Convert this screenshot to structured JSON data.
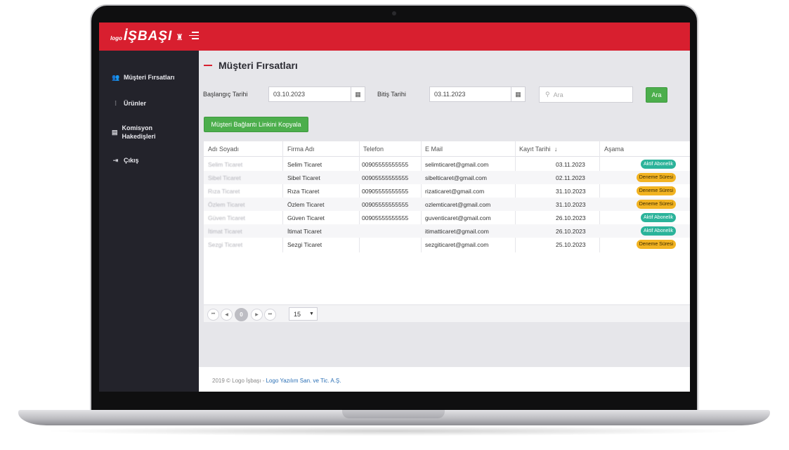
{
  "app": {
    "logo_small": "logo",
    "logo_main": "İŞBAŞI"
  },
  "sidebar": {
    "items": [
      {
        "label": "Müşteri Fırsatları",
        "icon": "users-icon"
      },
      {
        "label": "Ürünler",
        "icon": "sliders-icon"
      },
      {
        "label": "Komisyon Hakedişleri",
        "icon": "document-icon"
      },
      {
        "label": "Çıkış",
        "icon": "logout-icon"
      }
    ]
  },
  "page": {
    "title": "Müşteri Fırsatları"
  },
  "filters": {
    "start_label": "Başlangıç Tarihi",
    "start_value": "03.10.2023",
    "end_label": "Bitiş Tarihi",
    "end_value": "03.11.2023",
    "search_placeholder": "Ara",
    "search_button": "Ara",
    "copy_link_button": "Müşteri Bağlantı Linkini Kopyala"
  },
  "table": {
    "headers": [
      "Adı Soyadı",
      "Firma Adı",
      "Telefon",
      "E Mail",
      "Kayıt Tarihi",
      "Aşama"
    ],
    "sort_indicator": "↓",
    "rows": [
      [
        "Selim Ticaret",
        "Selim Ticaret",
        "00905555555555",
        "selimticaret@gmail.com",
        "03.11.2023",
        "Aktif Abonelik"
      ],
      [
        "Sibel Ticaret",
        "Sibel Ticaret",
        "00905555555555",
        "sibelticaret@gmail.com",
        "02.11.2023",
        "Deneme Süresi"
      ],
      [
        "Rıza Ticaret",
        "Rıza Ticaret",
        "00905555555555",
        "rizaticaret@gmail.com",
        "31.10.2023",
        "Deneme Süresi"
      ],
      [
        "Özlem Ticaret",
        "Özlem Ticaret",
        "00905555555555",
        "ozlemticaret@gmail.com",
        "31.10.2023",
        "Deneme Süresi"
      ],
      [
        "Güven Ticaret",
        "Güven Ticaret",
        "00905555555555",
        "guventicaret@gmail.com",
        "26.10.2023",
        "Aktif Abonelik"
      ],
      [
        "İtimat Ticaret",
        "İtimat Ticaret",
        "",
        "itimatticaret@gmail.com",
        "26.10.2023",
        "Aktif Abonelik"
      ],
      [
        "Sezgi Ticaret",
        "Sezgi Ticaret",
        "",
        "sezgiticaret@gmail.com",
        "25.10.2023",
        "Deneme Süresi"
      ]
    ]
  },
  "pager": {
    "current_page": "0",
    "first": "⏮",
    "prev": "◀",
    "next": "▶",
    "last": "⏭",
    "page_size": "15"
  },
  "footer": {
    "text": "2019 © Logo İşbaşı - ",
    "link": "Logo Yazılım San. ve Tic. A.Ş."
  },
  "colors": {
    "brand_red": "#d81f2f",
    "sidebar_bg": "#23232b",
    "green": "#4cae4c",
    "aktif": "#2bb39a",
    "deneme": "#f2b321"
  }
}
